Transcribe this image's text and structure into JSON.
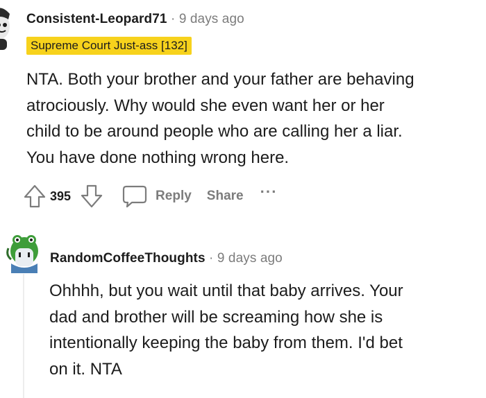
{
  "comment1": {
    "username": "Consistent-Leopard71",
    "separator": "·",
    "time": "9 days ago",
    "flair": "Supreme Court Just-ass [132]",
    "body_lines": [
      "NTA. Both your brother and your father are behaving",
      "atrociously. Why would she even want her or her",
      "child to be around people who are calling her a liar.",
      "You have done nothing wrong here."
    ],
    "votes": "395",
    "reply_label": "Reply",
    "share_label": "Share",
    "more_label": "···"
  },
  "comment2": {
    "username": "RandomCoffeeThoughts",
    "separator": "·",
    "time": "9 days ago",
    "body_lines": [
      "Ohhhh, but you wait until that baby arrives. Your",
      "dad and brother will be screaming how she is",
      "intentionally keeping the baby from them. I'd bet",
      "on it. NTA"
    ]
  },
  "colors": {
    "flair_bg": "#f7d21c",
    "meta_gray": "#7c7c7c",
    "text": "#1c1c1c",
    "thread_line": "#ededed"
  },
  "icons": [
    "avatar-snoo",
    "upvote-arrow",
    "downvote-arrow",
    "comment-bubble",
    "avatar-frog"
  ]
}
